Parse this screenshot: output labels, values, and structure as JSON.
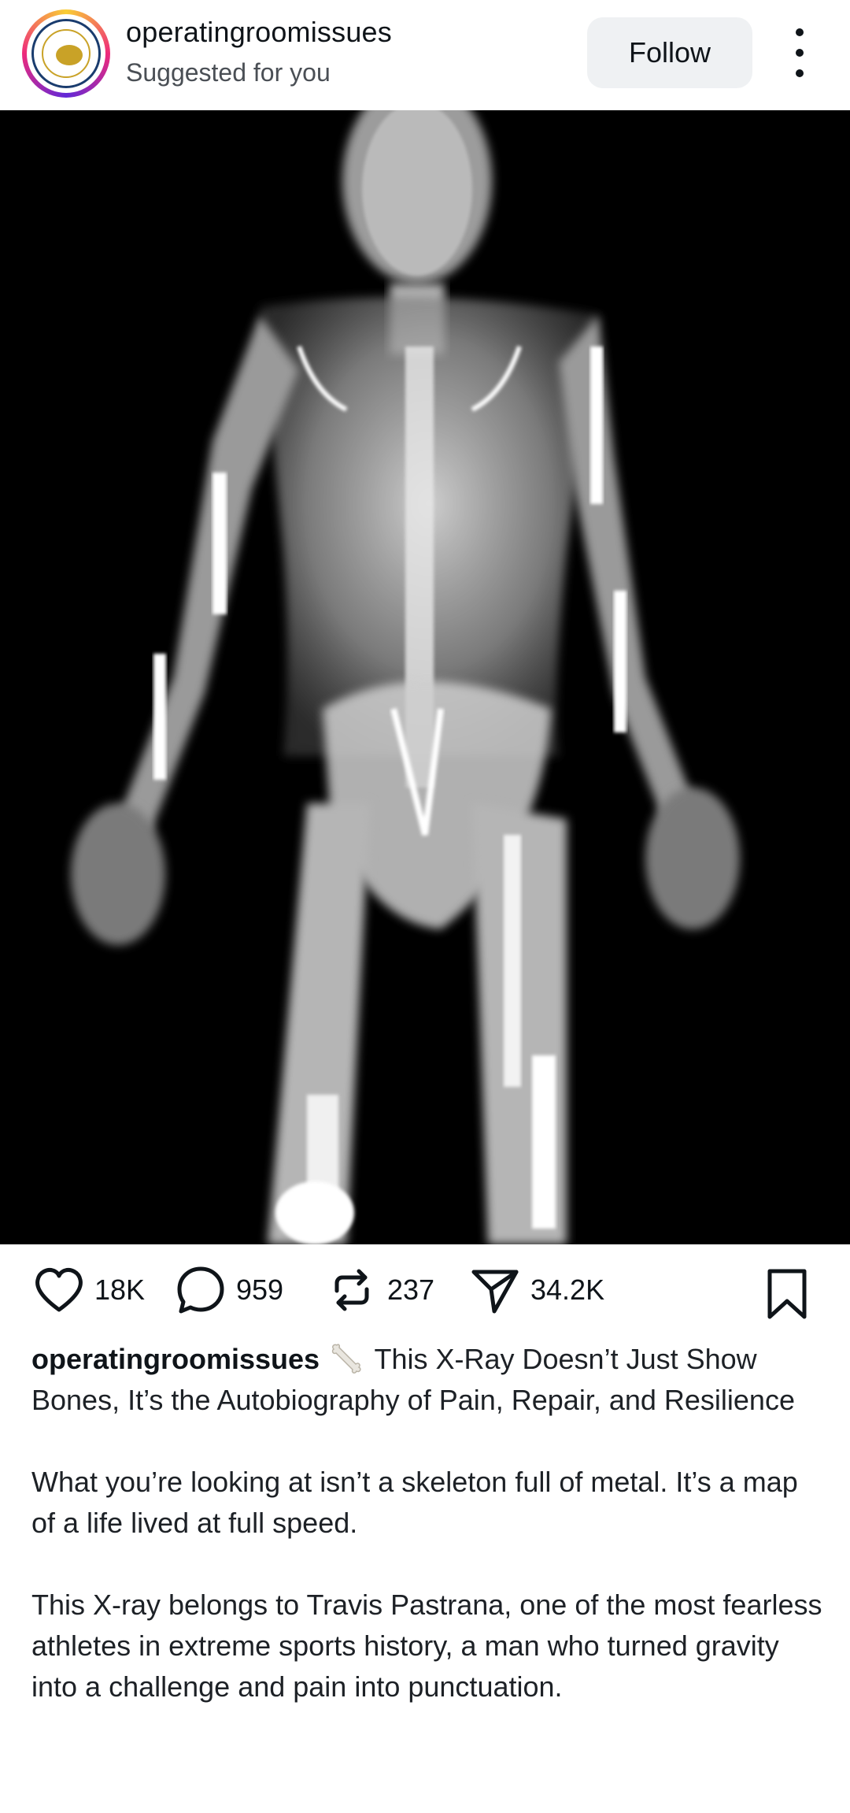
{
  "post": {
    "username": "operatingroomissues",
    "subtitle": "Suggested for you",
    "follow_label": "Follow",
    "image_description_icon": "xray-image"
  },
  "actions": {
    "likes": "18K",
    "comments": "959",
    "reposts": "237",
    "shares": "34.2K"
  },
  "caption": {
    "username": "operatingroomissues",
    "emoji": "bone-emoji",
    "headline": "This X-Ray Doesn’t Just Show Bones, It’s the Autobiography of Pain, Repair, and Resilience",
    "para1": "What you’re looking at isn’t a skeleton full of metal. It’s a map of a life lived at full speed.",
    "para2": "This X-ray belongs to Travis Pastrana, one of the most fearless athletes in extreme sports history, a man who turned gravity into a challenge and pain into punctuation."
  },
  "colors": {
    "follow_bg": "#eff1f3",
    "text": "#0f1419",
    "photo_bg": "#000000"
  }
}
